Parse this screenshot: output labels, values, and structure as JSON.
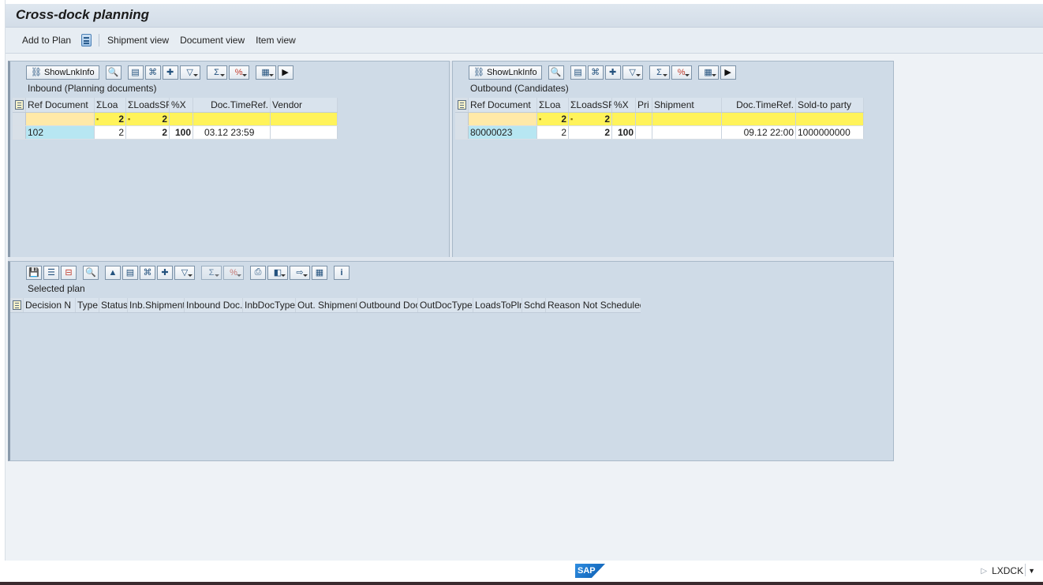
{
  "title": "Cross-dock planning",
  "appbar": {
    "add_to_plan": "Add to Plan",
    "shipment_view": "Shipment view",
    "document_view": "Document view",
    "item_view": "Item view"
  },
  "toolbar": {
    "show_lnk_info": "ShowLnkInfo"
  },
  "inbound": {
    "title": "Inbound (Planning documents)",
    "columns": [
      "Ref Document",
      "ΣLoa",
      "ΣLoadsSR",
      "%X",
      "Doc.TimeRef.",
      "Vendor"
    ],
    "sum_row": [
      "",
      "2",
      "2",
      "",
      "",
      ""
    ],
    "data_row": [
      "102",
      "2",
      "2",
      "100",
      "03.12 23:59",
      ""
    ]
  },
  "outbound": {
    "title": "Outbound (Candidates)",
    "columns": [
      "Ref Document",
      "ΣLoa",
      "ΣLoadsSR",
      "%X",
      "Pri",
      "Shipment",
      "Doc.TimeRef.",
      "Sold-to party"
    ],
    "sum_row": [
      "",
      "2",
      "2",
      "",
      "",
      "",
      "",
      ""
    ],
    "data_row": [
      "80000023",
      "2",
      "2",
      "100",
      "",
      "",
      "09.12 22:00",
      "1000000000"
    ]
  },
  "plan": {
    "title": "Selected plan",
    "columns": [
      "Decision N",
      "Type",
      "Status",
      "Inb.Shipment",
      "Inbound Doc.",
      "InbDocType",
      "Out. Shipment",
      "Outbound Doc",
      "OutDocType",
      "LoadsToPln",
      "Schdl",
      "Reason Not Scheduled"
    ]
  },
  "footer": {
    "logo": "SAP",
    "system": "LXDCK"
  }
}
